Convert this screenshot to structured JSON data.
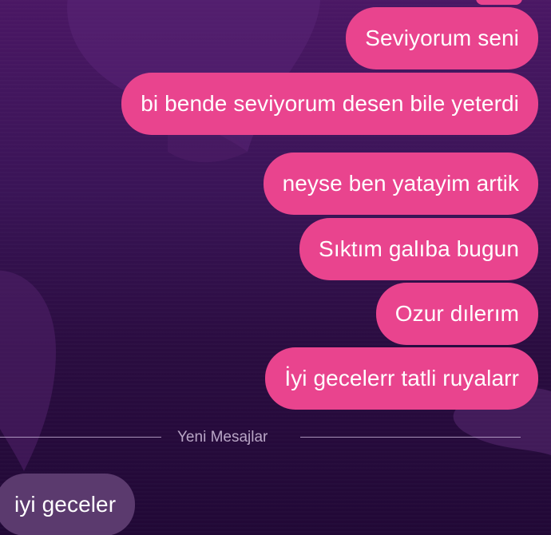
{
  "theme": {
    "outgoing_bubble_color": "#e9448e",
    "incoming_bubble_color": "#5b3a6e",
    "background_color": "#2a0c40",
    "divider_text_color": "#b9a6c6"
  },
  "chat": {
    "messages_sent": [
      {
        "text": "Seviyorum seni"
      },
      {
        "text": "bi bende seviyorum desen bile yeterdi"
      },
      {
        "text": "neyse ben yatayim artik"
      },
      {
        "text": "Sıktım galıba bugun"
      },
      {
        "text": "Ozur dılerım"
      },
      {
        "text": "İyi gecelerr tatli ruyalarr"
      }
    ],
    "new_messages_divider": "Yeni Mesajlar",
    "messages_received": [
      {
        "text": "iyi geceler"
      }
    ]
  }
}
